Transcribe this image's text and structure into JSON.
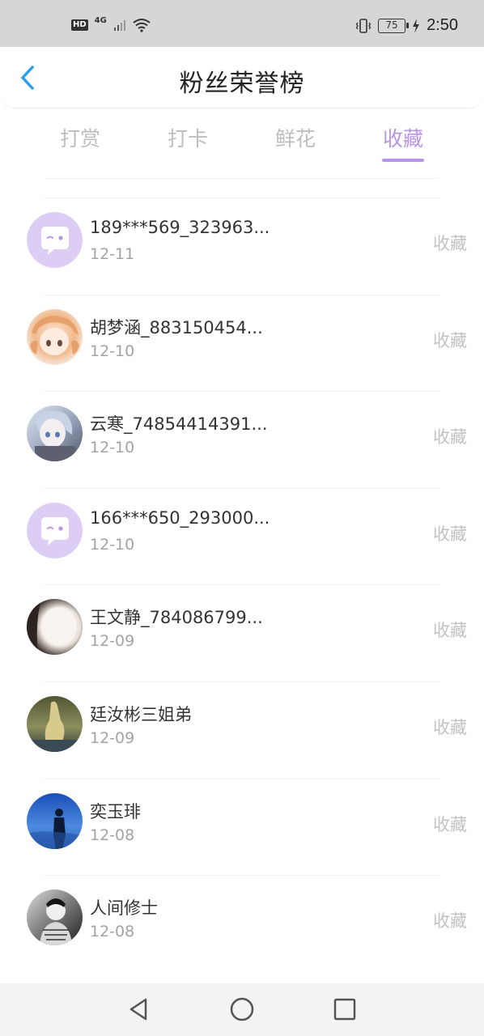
{
  "status_bar": {
    "hd": "HD",
    "network": "4G",
    "battery": "75",
    "time": "2:50"
  },
  "header": {
    "title": "粉丝荣誉榜"
  },
  "tabs": [
    {
      "label": "打赏",
      "active": false
    },
    {
      "label": "打卡",
      "active": false
    },
    {
      "label": "鲜花",
      "active": false
    },
    {
      "label": "收藏",
      "active": true
    }
  ],
  "fans": [
    {
      "name": "189***569_323963...",
      "date": "12-11",
      "action": "收藏",
      "avatar": "chat-bubble-default"
    },
    {
      "name": "胡梦涵_883150454...",
      "date": "12-10",
      "action": "收藏",
      "avatar": "anime-girl-orange"
    },
    {
      "name": "云寒_74854414391...",
      "date": "12-10",
      "action": "收藏",
      "avatar": "anime-girl-silver"
    },
    {
      "name": "166***650_293000...",
      "date": "12-10",
      "action": "收藏",
      "avatar": "chat-bubble-default"
    },
    {
      "name": "王文静_784086799...",
      "date": "12-09",
      "action": "收藏",
      "avatar": "white-animal-photo"
    },
    {
      "name": "廷汝彬三姐弟",
      "date": "12-09",
      "action": "收藏",
      "avatar": "dusk-statue-photo"
    },
    {
      "name": "奕玉琲",
      "date": "12-08",
      "action": "收藏",
      "avatar": "blue-sky-silhouette"
    },
    {
      "name": "人间修士",
      "date": "12-08",
      "action": "收藏",
      "avatar": "bw-portrait-photo"
    }
  ],
  "colors": {
    "accent": "#b994e6",
    "tab_inactive": "#bdbdbd",
    "back_arrow": "#2e9cf0"
  }
}
